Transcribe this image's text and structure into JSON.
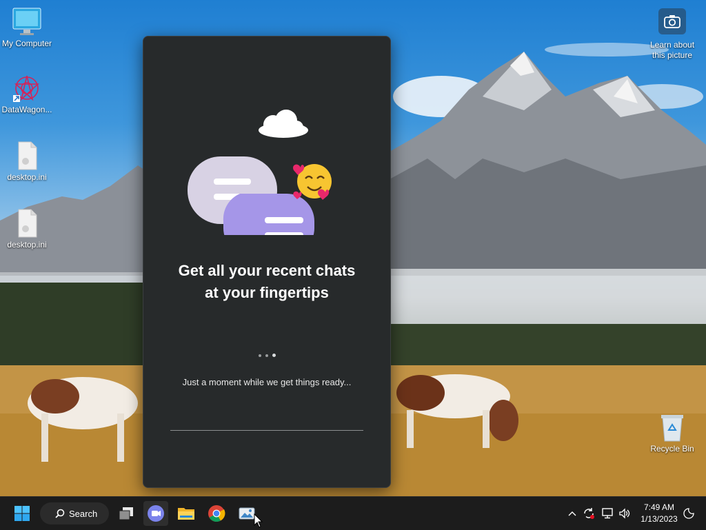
{
  "desktop": {
    "icons": [
      {
        "label": "My Computer",
        "icon": "monitor-icon"
      },
      {
        "label": "DataWagon...",
        "icon": "datawagon-icon"
      },
      {
        "label": "desktop.ini",
        "icon": "file-icon"
      },
      {
        "label": "desktop.ini",
        "icon": "file-icon"
      },
      {
        "label": "Recycle Bin",
        "icon": "recycle-bin-icon"
      }
    ],
    "learn_picture": {
      "label": "Learn about this picture",
      "icon": "camera-icon"
    }
  },
  "chat": {
    "title_line1": "Get all your recent chats",
    "title_line2": "at your fingertips",
    "status": "Just a moment while we get things ready...",
    "loading_dots": 3,
    "accent_light": "#d8d2e4",
    "accent_purple": "#a596e8"
  },
  "taskbar": {
    "search_label": "Search",
    "apps": [
      "start-icon",
      "search-icon",
      "task-view-icon",
      "teams-chat-icon",
      "file-explorer-icon",
      "chrome-icon",
      "photos-icon"
    ],
    "tray": [
      "chevron-up-icon",
      "sync-icon",
      "network-icon",
      "volume-icon",
      "notification-icon"
    ],
    "time": "7:49 AM",
    "date": "1/13/2023"
  }
}
